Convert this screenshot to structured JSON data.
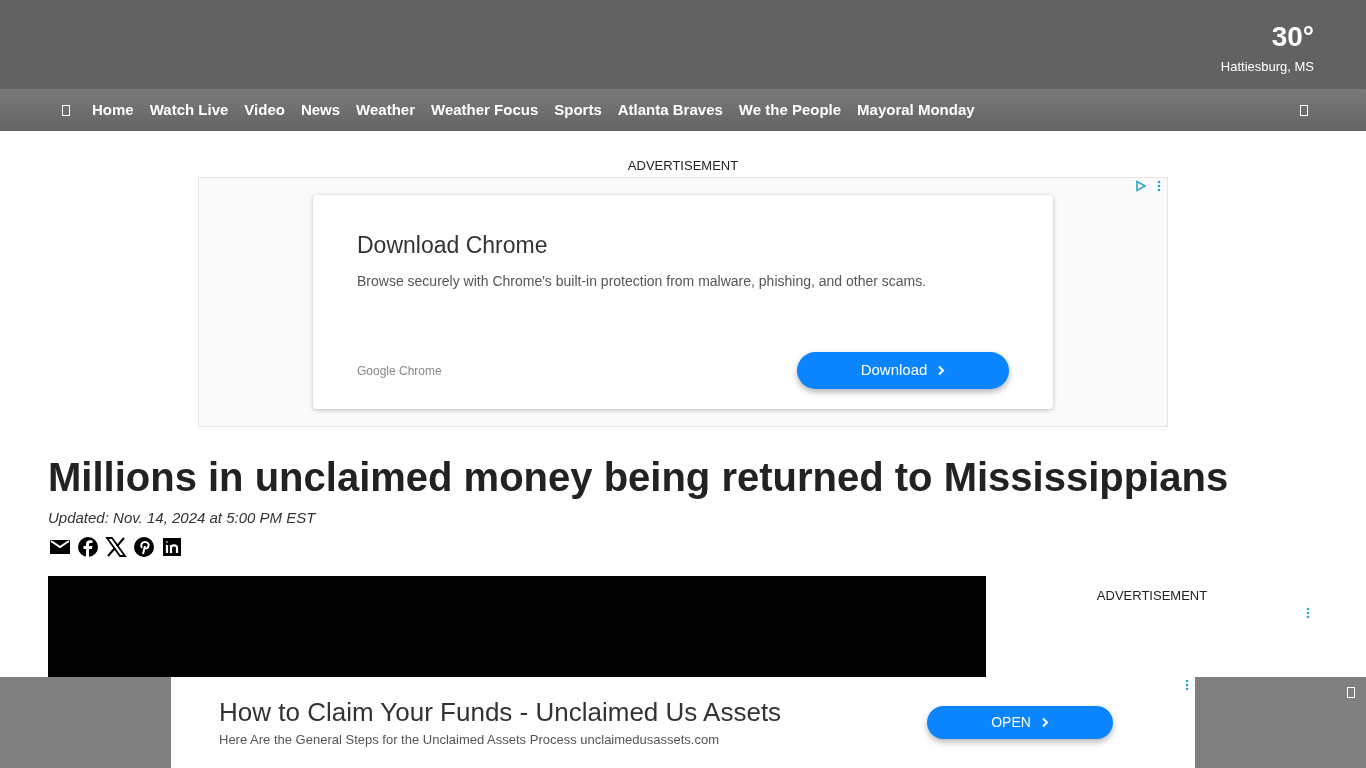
{
  "weather": {
    "temperature": "30°",
    "location": "Hattiesburg, MS"
  },
  "nav": {
    "items": [
      {
        "label": "Home"
      },
      {
        "label": "Watch Live"
      },
      {
        "label": "Video"
      },
      {
        "label": "News"
      },
      {
        "label": "Weather"
      },
      {
        "label": "Weather Focus"
      },
      {
        "label": "Sports"
      },
      {
        "label": "Atlanta Braves"
      },
      {
        "label": "We the People"
      },
      {
        "label": "Mayoral Monday"
      }
    ]
  },
  "top_ad": {
    "label": "ADVERTISEMENT",
    "title": "Download Chrome",
    "text": "Browse securely with Chrome's built-in protection from malware, phishing, and other scams.",
    "advertiser": "Google Chrome",
    "button": "Download"
  },
  "article": {
    "headline": "Millions in unclaimed money being returned to Mississippians",
    "updated": "Updated: Nov. 14, 2024 at 5:00 PM EST"
  },
  "sidebar_ad": {
    "label": "ADVERTISEMENT"
  },
  "sticky_ad": {
    "title": "How to Claim Your Funds - Unclaimed Us Assets",
    "text": "Here Are the General Steps for the Unclaimed Assets Process unclaimedusassets.com",
    "button": "OPEN"
  }
}
